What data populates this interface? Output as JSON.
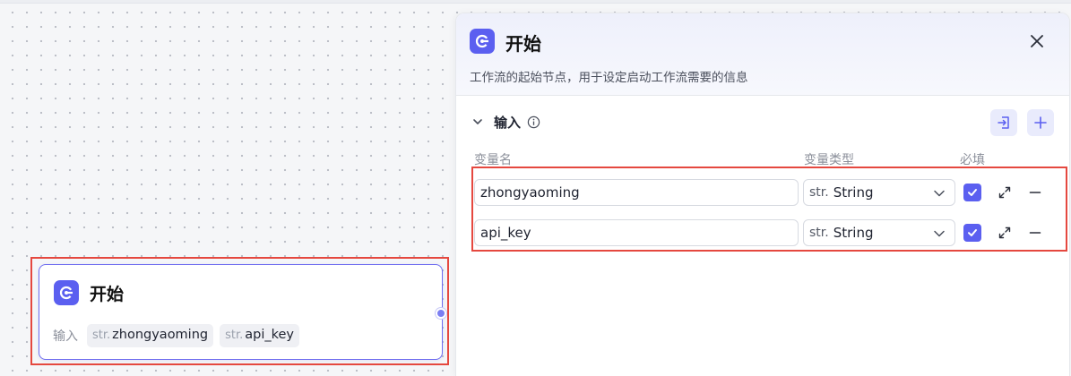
{
  "node": {
    "title": "开始",
    "inputs_label": "输入",
    "chips": [
      {
        "type": "str.",
        "name": "zhongyaoming"
      },
      {
        "type": "str.",
        "name": "api_key"
      }
    ]
  },
  "panel": {
    "title": "开始",
    "description": "工作流的起始节点，用于设定启动工作流需要的信息",
    "section_title": "输入",
    "columns": {
      "name": "变量名",
      "type": "变量类型",
      "required": "必填"
    },
    "rows": [
      {
        "name": "zhongyaoming",
        "type_prefix": "str.",
        "type": "String",
        "required": true
      },
      {
        "name": "api_key",
        "type_prefix": "str.",
        "type": "String",
        "required": true
      }
    ]
  },
  "icons": {
    "app": "start-node-icon",
    "close": "close-icon",
    "collapse": "chevron-down-icon",
    "info": "info-icon",
    "import": "import-icon",
    "add": "plus-icon",
    "expand": "expand-icon",
    "remove": "minus-icon",
    "dropdown": "chevron-down-icon",
    "check": "check-icon"
  },
  "colors": {
    "accent": "#5b5ff0",
    "highlight": "#e5483f",
    "node_border": "#6e6cf0"
  }
}
